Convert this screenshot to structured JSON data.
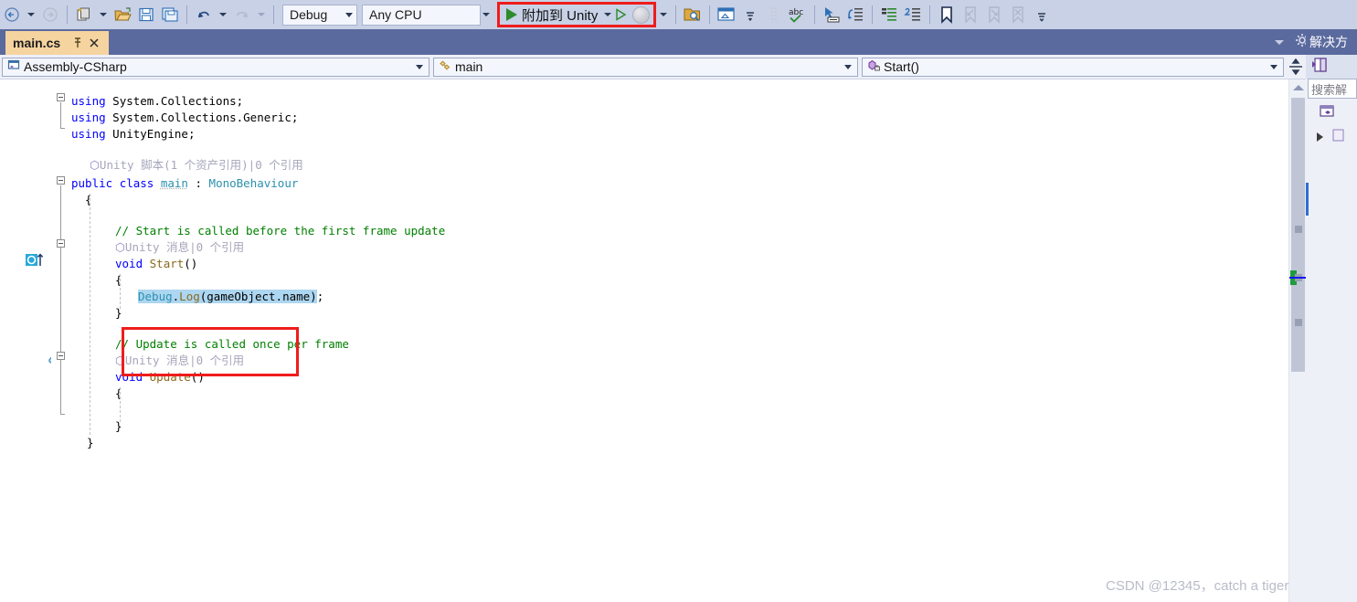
{
  "toolbar": {
    "nav_back_icon": "navigate-back-icon",
    "nav_forward_icon": "navigate-forward-icon",
    "new_project_icon": "new-project-icon",
    "open_file_icon": "open-file-icon",
    "save_icon": "save-icon",
    "save_all_icon": "save-all-icon",
    "undo_icon": "undo-icon",
    "redo_icon": "redo-icon",
    "config_value": "Debug",
    "platform_value": "Any CPU",
    "run_label": "附加到 Unity",
    "find_in_files_icon": "find-in-files-icon",
    "window_layout_icon": "window-layout-icon",
    "spellcheck_icon": "spellcheck-abc-icon",
    "nav_to_icon": "navigate-to-icon",
    "indent_icon": "increase-indent-icon",
    "comment_icon": "comment-selection-icon",
    "uncomment_icon": "uncomment-selection-icon",
    "bookmark_icon": "bookmark-icon",
    "prev_bookmark_icon": "previous-bookmark-icon",
    "next_bookmark_icon": "next-bookmark-icon",
    "clear_bookmarks_icon": "clear-bookmarks-icon",
    "overflow_icon": "toolbar-overflow-icon"
  },
  "tabs": {
    "active_title": "main.cs",
    "pin_icon": "pin-tab-icon",
    "close_icon": "close-tab-icon",
    "dropdown_icon": "tab-list-dropdown-icon",
    "settings_icon": "gear-icon"
  },
  "navbar": {
    "project": "Assembly-CSharp",
    "type": "main",
    "member": "Start()",
    "project_icon": "project-icon",
    "type_icon": "class-icon",
    "member_icon": "method-lock-icon",
    "split_icon": "split-editor-icon"
  },
  "editor": {
    "codelens_class": "Unity 脚本(1 个资产引用)|0 个引用",
    "codelens_start": "Unity 消息|0 个引用",
    "codelens_update": "Unity 消息|0 个引用",
    "lines": [
      "using System.Collections;",
      "using System.Collections.Generic;",
      "using UnityEngine;",
      "",
      "public class main : MonoBehaviour",
      "{",
      "    // Start is called before the first frame update",
      "    void Start()",
      "    {",
      "        Debug.Log(gameObject.name);",
      "    }",
      "",
      "    // Update is called once per frame",
      "    void Update()",
      "    {",
      "",
      "    }",
      "}"
    ],
    "selected_text": "Debug.Log(gameObject.name)",
    "tokens": {
      "using": "using",
      "ns_collections": "System.Collections;",
      "ns_generic": "System.Collections.Generic;",
      "ns_unity": "UnityEngine;",
      "public": "public",
      "class": "class",
      "class_name": "main",
      "colon": " : ",
      "base_type": "MonoBehaviour",
      "brace_open": "{",
      "brace_close": "}",
      "comment_start": "// Start is called before the first frame update",
      "comment_update": "// Update is called once per frame",
      "void": "void",
      "start_method": "Start",
      "update_method": "Update",
      "parens": "()",
      "debug": "Debug",
      "dot": ".",
      "log": "Log",
      "paren_open": "(",
      "gameobject_name": "gameObject.name",
      "paren_close": ")",
      "semicolon": ";"
    },
    "gutter": {
      "unity_icon": "unity-codelens-icon",
      "quickaction_icon": "quick-actions-screwdriver-icon",
      "change_bar_icon": "unsaved-change-bar-icon"
    }
  },
  "scrollbar": {
    "up_arrow_icon": "scroll-up-arrow-icon",
    "thumb_icon": "scrollbar-thumb",
    "change_marker_icon": "change-marker-green",
    "caret_marker_icon": "caret-position-marker-blue"
  },
  "right_dock": {
    "title": "解决方",
    "toolbar_icon": "solution-explorer-icon",
    "search_placeholder": "搜索解",
    "project_icon": "solution-node-icon",
    "expand_icon": "expand-arrow-icon"
  },
  "watermark": {
    "text": "CSDN @12345，catch a tiger"
  },
  "colors": {
    "toolbar_bg": "#c8d1e6",
    "tabbar_bg": "#5b6a9e",
    "active_tab_bg": "#f5d4a0",
    "annotation_red": "#ee1c1c",
    "selection_blue": "#add6f0",
    "keyword_blue": "#0000ff",
    "type_teal": "#2b91af",
    "comment_green": "#008000",
    "method_gold": "#8a6a1d"
  }
}
